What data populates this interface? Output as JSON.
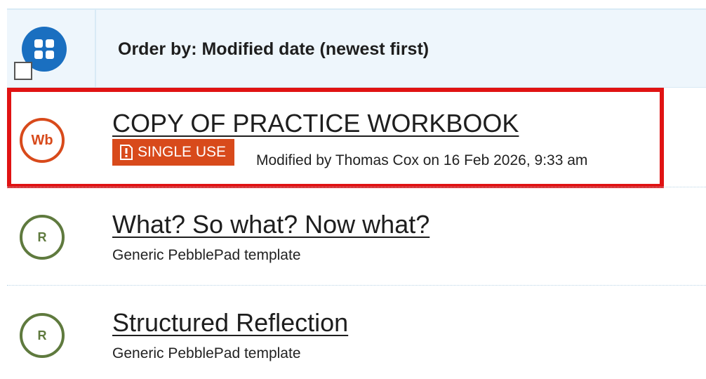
{
  "header": {
    "order_by_label": "Order by: Modified date (newest first)",
    "grid_icon": "grid-icon"
  },
  "items": [
    {
      "type_label": "Wb",
      "type_color": "#d84a1b",
      "title": "COPY OF PRACTICE WORKBOOK",
      "badge": "SINGLE USE",
      "badge_icon": "single-use-icon",
      "subtitle": "Modified by Thomas Cox on 16 Feb 2026, 9:33 am",
      "highlighted": true
    },
    {
      "type_label": "R",
      "type_color": "#5f7a3e",
      "title": "What? So what? Now what?",
      "subtitle": "Generic PebblePad template"
    },
    {
      "type_label": "R",
      "type_color": "#5f7a3e",
      "title": "Structured Reflection",
      "subtitle": "Generic PebblePad template"
    }
  ],
  "colors": {
    "header_bg": "#eef6fc",
    "accent_blue": "#1a6fc0",
    "workbook_orange": "#d84a1b",
    "resource_green": "#5f7a3e",
    "highlight_red": "#e01313"
  }
}
